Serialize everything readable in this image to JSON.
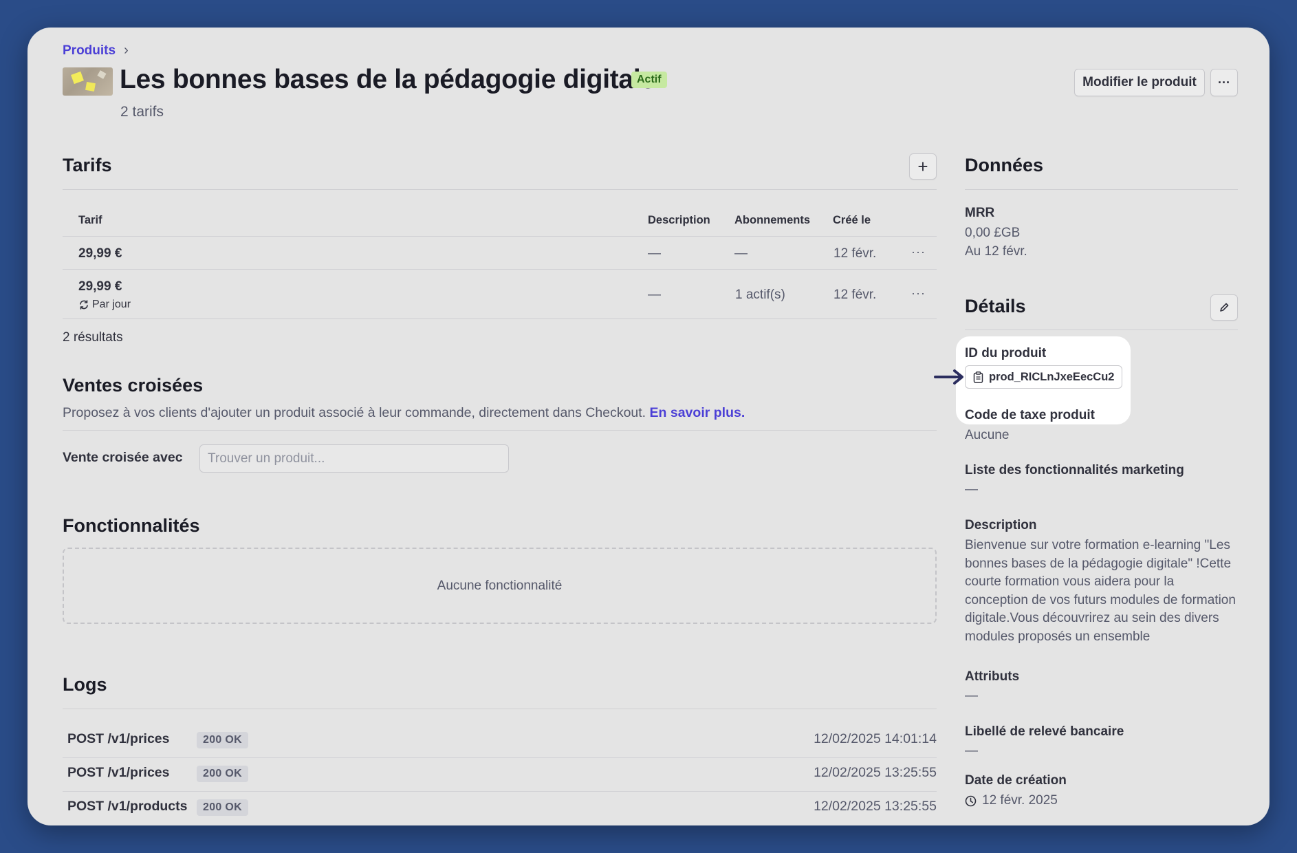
{
  "breadcrumb": {
    "parent": "Produits",
    "separator": "›"
  },
  "product": {
    "title": "Les bonnes bases de la pédagogie digitale",
    "status": "Actif",
    "subtitle": "2 tarifs"
  },
  "actions": {
    "edit_label": "Modifier le produit",
    "more_label": "···"
  },
  "pricing": {
    "title": "Tarifs",
    "add_label": "+",
    "columns": [
      "Tarif",
      "Description",
      "Abonnements",
      "Créé le"
    ],
    "rows": [
      {
        "price": "29,99 €",
        "recurring": "",
        "description": "—",
        "subscriptions": "—",
        "created": "12 févr."
      },
      {
        "price": "29,99 €",
        "recurring": "Par jour",
        "description": "—",
        "subscriptions": "1 actif(s)",
        "created": "12 févr."
      }
    ],
    "row_more": "···",
    "results": "2 résultats"
  },
  "cross_sell": {
    "title": "Ventes croisées",
    "description": "Proposez à vos clients d'ajouter un produit associé à leur commande, directement dans Checkout.",
    "learn_more": "En savoir plus.",
    "field_label": "Vente croisée avec",
    "placeholder": "Trouver un produit..."
  },
  "features": {
    "title": "Fonctionnalités",
    "empty": "Aucune fonctionnalité"
  },
  "logs": {
    "title": "Logs",
    "entries": [
      {
        "endpoint": "POST /v1/prices",
        "status": "200 OK",
        "time": "12/02/2025 14:01:14"
      },
      {
        "endpoint": "POST /v1/prices",
        "status": "200 OK",
        "time": "12/02/2025 13:25:55"
      },
      {
        "endpoint": "POST /v1/products",
        "status": "200 OK",
        "time": "12/02/2025 13:25:55"
      }
    ]
  },
  "data_panel": {
    "title": "Données",
    "mrr_label": "MRR",
    "mrr_value": "0,00 £GB",
    "mrr_date": "Au 12 févr."
  },
  "details": {
    "title": "Détails",
    "product_id_label": "ID du produit",
    "product_id": "prod_RICLnJxeEecCu2",
    "tax_code_label": "Code de taxe produit",
    "tax_code": "Aucune",
    "marketing_label": "Liste des fonctionnalités marketing",
    "marketing_value": "—",
    "description_label": "Description",
    "description": "Bienvenue sur votre formation e-learning \"Les bonnes bases de la pédagogie digitale\" !Cette courte formation vous aidera pour la conception de vos futurs modules de formation digitale.Vous découvrirez au sein des divers modules proposés un ensemble",
    "attributes_label": "Attributs",
    "attributes_value": "—",
    "statement_label": "Libellé de relevé bancaire",
    "statement_value": "—",
    "created_label": "Date de création",
    "created_value": "12 févr. 2025"
  },
  "colors": {
    "background": "#2a4c88",
    "card": "#e4e4e4",
    "accent": "#4b3fd6",
    "badge_active_bg": "#c6e9a1",
    "badge_active_text": "#2b6a1a",
    "arrow": "#2b2d5e"
  },
  "icons": [
    "chevron-right-icon",
    "plus-icon",
    "more-icon",
    "recurring-icon",
    "pencil-icon",
    "clipboard-icon",
    "arrow-right-icon",
    "clock-icon"
  ]
}
